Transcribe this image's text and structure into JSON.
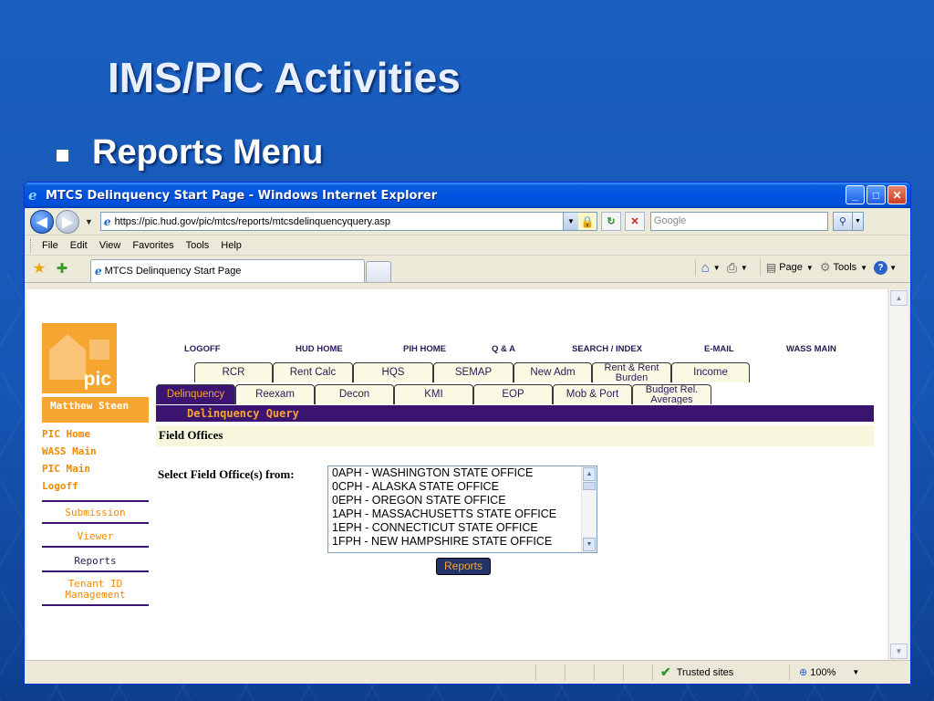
{
  "slide": {
    "title": "IMS/PIC Activities",
    "bullet": "Reports Menu"
  },
  "window": {
    "title": "MTCS Delinquency Start Page - Windows Internet Explorer",
    "buttons": {
      "minimize": "_",
      "maximize": "□",
      "close": "✕"
    }
  },
  "address": {
    "url": "https://pic.hud.gov/pic/mtcs/reports/mtcsdelinquencyquery.asp",
    "search_placeholder": "Google"
  },
  "menu": [
    "File",
    "Edit",
    "View",
    "Favorites",
    "Tools",
    "Help"
  ],
  "tab": {
    "title": "MTCS Delinquency Start Page"
  },
  "commandbar": {
    "page": "Page",
    "tools": "Tools"
  },
  "status": {
    "zone": "Trusted sites",
    "zoom": "100%"
  },
  "pic": {
    "logo_text": "pic",
    "user": "Matthew Steen",
    "links": [
      "PIC Home",
      "WASS Main",
      "PIC Main",
      "Logoff"
    ],
    "sub_links": [
      {
        "label": "Submission",
        "active": false
      },
      {
        "label": "Viewer",
        "active": false
      },
      {
        "label": "Reports",
        "active": true
      },
      {
        "label": "Tenant ID Management",
        "active": false
      }
    ],
    "top_nav": [
      "LOGOFF",
      "HUD HOME",
      "PIH HOME",
      "Q & A",
      "SEARCH / INDEX",
      "E-MAIL",
      "WASS MAIN"
    ],
    "tabs_row1": [
      "RCR",
      "Rent Calc",
      "HQS",
      "SEMAP",
      "New Adm",
      "Rent & Rent Burden",
      "Income"
    ],
    "tabs_row2": [
      "Delinquency",
      "Reexam",
      "Decon",
      "KMI",
      "EOP",
      "Mob & Port",
      "Budget Rel. Averages"
    ],
    "section_title": "Delinquency Query",
    "field_offices_heading": "Field Offices",
    "select_label": "Select Field Office(s) from:",
    "field_offices": [
      "0APH - WASHINGTON STATE OFFICE",
      "0CPH - ALASKA STATE OFFICE",
      "0EPH - OREGON STATE OFFICE",
      "1APH - MASSACHUSETTS STATE OFFICE",
      "1EPH - CONNECTICUT STATE OFFICE",
      "1FPH - NEW HAMPSHIRE STATE OFFICE"
    ],
    "reports_button": "Reports"
  },
  "colors": {
    "pic_orange": "#f7a531",
    "pic_purple": "#3b1470",
    "slide_blue": "#1656b5"
  }
}
